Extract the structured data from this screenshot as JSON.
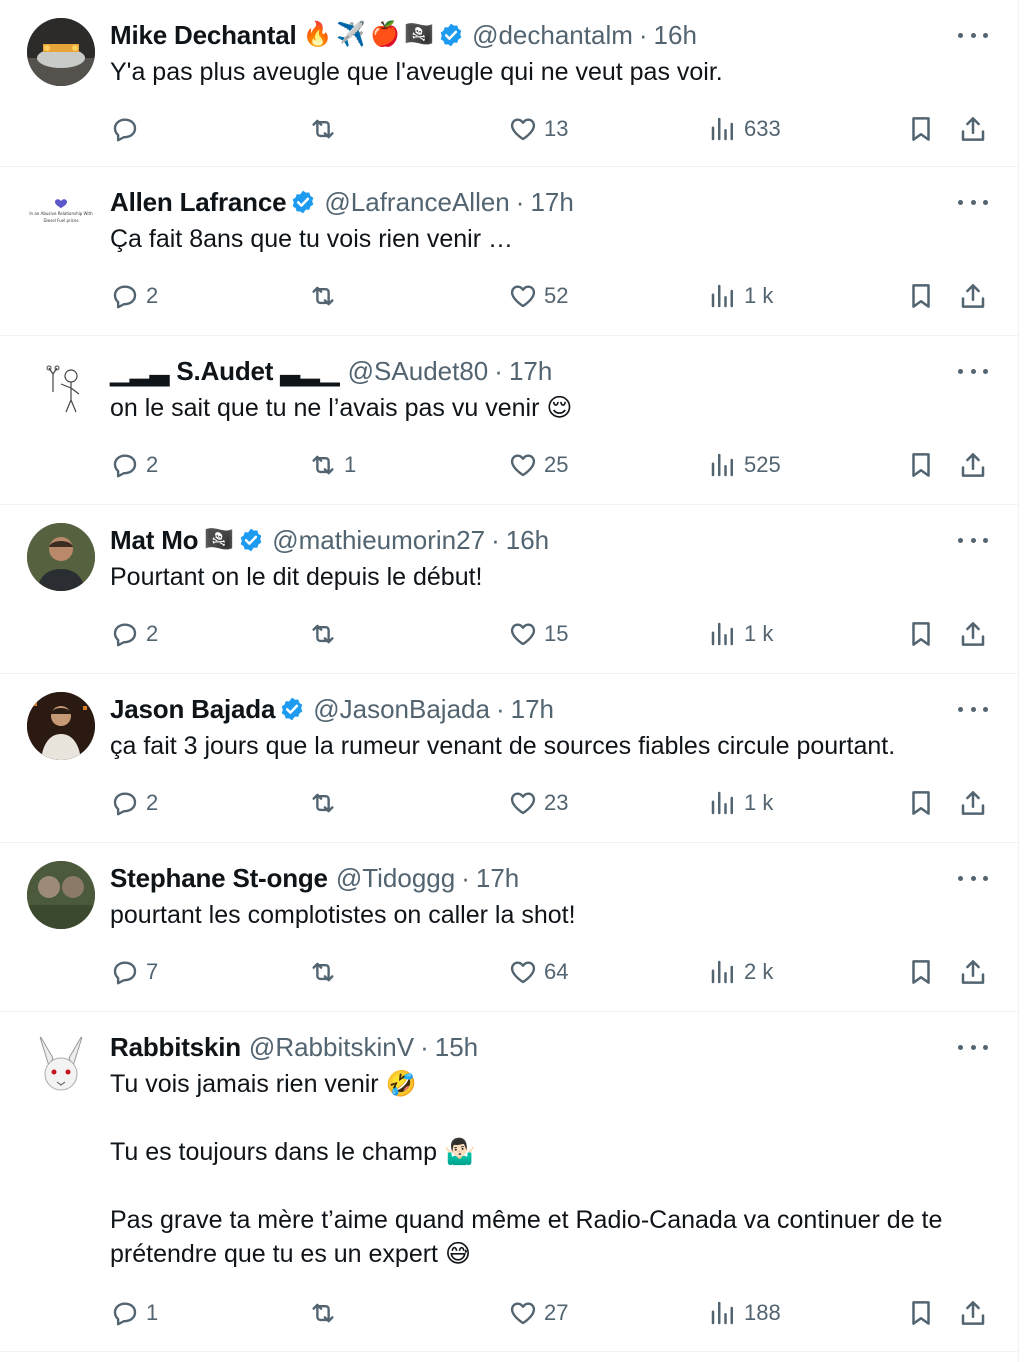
{
  "tweets": [
    {
      "name": "Mike Dechantal",
      "badges": [
        "🔥",
        "✈️",
        "🍎",
        "🏴‍☠️"
      ],
      "verified": true,
      "handle": "@dechantalm",
      "sep": "·",
      "time": "16h",
      "text": [
        "Y'a pas plus aveugle que l'aveugle qui ne veut pas voir."
      ],
      "replies": "",
      "reposts": "",
      "likes": "13",
      "views": "633"
    },
    {
      "name": "Allen Lafrance",
      "badges": [],
      "verified": true,
      "handle": "@LafranceAllen",
      "sep": "·",
      "time": "17h",
      "text": [
        "Ça fait 8ans que tu vois rien venir …"
      ],
      "replies": "2",
      "reposts": "",
      "likes": "52",
      "views": "1 k"
    },
    {
      "name": "▁▂▃ S.Audet ▃▂▁",
      "badges": [],
      "verified": false,
      "handle": "@SAudet80",
      "sep": "·",
      "time": "17h",
      "text": [
        "on le sait que tu ne l’avais pas vu venir 😌"
      ],
      "replies": "2",
      "reposts": "1",
      "likes": "25",
      "views": "525"
    },
    {
      "name": "Mat Mo",
      "badges": [
        "🏴‍☠️"
      ],
      "verified": true,
      "handle": "@mathieumorin27",
      "sep": "·",
      "time": "16h",
      "text": [
        "Pourtant on le dit depuis le début!"
      ],
      "replies": "2",
      "reposts": "",
      "likes": "15",
      "views": "1 k"
    },
    {
      "name": "Jason Bajada",
      "badges": [],
      "verified": true,
      "handle": "@JasonBajada",
      "sep": "·",
      "time": "17h",
      "text": [
        "ça fait 3 jours que la rumeur venant de sources fiables circule pourtant."
      ],
      "replies": "2",
      "reposts": "",
      "likes": "23",
      "views": "1 k"
    },
    {
      "name": "Stephane St-onge",
      "badges": [],
      "verified": false,
      "handle": "@Tidoggg",
      "sep": "·",
      "time": "17h",
      "text": [
        "pourtant les complotistes on caller la shot!"
      ],
      "replies": "7",
      "reposts": "",
      "likes": "64",
      "views": "2 k"
    },
    {
      "name": "Rabbitskin",
      "badges": [],
      "verified": false,
      "handle": "@RabbitskinV",
      "sep": "·",
      "time": "15h",
      "text": [
        "Tu vois jamais rien venir 🤣",
        "Tu es toujours dans le champ 🤷🏻‍♂️",
        "Pas grave ta mère t’aime quand même et Radio-Canada va continuer de te prétendre que tu es un expert 😅"
      ],
      "replies": "1",
      "reposts": "",
      "likes": "27",
      "views": "188"
    }
  ],
  "avatar_alt": {
    "allen_lines": [
      "In an Abusive Relationship With",
      "Diesel Fuel prices"
    ]
  },
  "colors": {
    "text": "#0f1419",
    "secondary": "#536471",
    "verified": "#1d9bf0",
    "divider": "#eff3f4"
  }
}
